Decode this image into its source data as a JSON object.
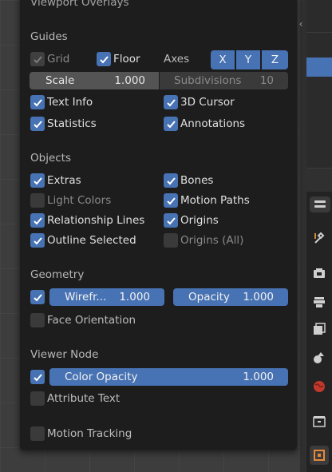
{
  "popover": {
    "title": "Viewport Overlays",
    "guides": {
      "heading": "Guides",
      "grid": {
        "label": "Grid",
        "checked": true
      },
      "floor": {
        "label": "Floor",
        "checked": true
      },
      "axes_label": "Axes",
      "axes": [
        {
          "label": "X",
          "active": true
        },
        {
          "label": "Y",
          "active": true
        },
        {
          "label": "Z",
          "active": true
        }
      ],
      "scale": {
        "label": "Scale",
        "value": "1.000"
      },
      "subdivisions": {
        "label": "Subdivisions",
        "value": "10"
      },
      "text_info": {
        "label": "Text Info",
        "checked": true
      },
      "cursor_3d": {
        "label": "3D Cursor",
        "checked": true
      },
      "statistics": {
        "label": "Statistics",
        "checked": true
      },
      "annotations": {
        "label": "Annotations",
        "checked": true
      }
    },
    "objects": {
      "heading": "Objects",
      "extras": {
        "label": "Extras",
        "checked": true
      },
      "bones": {
        "label": "Bones",
        "checked": true
      },
      "light_colors": {
        "label": "Light Colors",
        "checked": false
      },
      "motion_paths": {
        "label": "Motion Paths",
        "checked": true
      },
      "relationship_lines": {
        "label": "Relationship Lines",
        "checked": true
      },
      "origins": {
        "label": "Origins",
        "checked": true
      },
      "outline_selected": {
        "label": "Outline Selected",
        "checked": true
      },
      "origins_all": {
        "label": "Origins (All)",
        "checked": false
      }
    },
    "geometry": {
      "heading": "Geometry",
      "wireframe": {
        "label": "Wirefr...",
        "value": "1.000",
        "checked": true
      },
      "opacity": {
        "label": "Opacity",
        "value": "1.000"
      },
      "face_orientation": {
        "label": "Face Orientation",
        "checked": false
      }
    },
    "viewer_node": {
      "heading": "Viewer Node",
      "color_opacity": {
        "label": "Color Opacity",
        "value": "1.000",
        "checked": true
      },
      "attribute_text": {
        "label": "Attribute Text",
        "checked": false
      }
    },
    "motion_tracking": {
      "label": "Motion Tracking",
      "checked": false
    }
  },
  "sidebar_tabs": [
    {
      "icon": "tool-icon"
    },
    {
      "icon": "render-icon"
    },
    {
      "icon": "output-icon"
    },
    {
      "icon": "view-layer-icon"
    },
    {
      "icon": "scene-icon"
    },
    {
      "icon": "world-icon"
    },
    {
      "icon": "collection-icon"
    },
    {
      "icon": "object-icon"
    }
  ],
  "colors": {
    "accent": "#4772b3",
    "popover_bg": "#1d1d1d",
    "field_bg": "#545454"
  }
}
